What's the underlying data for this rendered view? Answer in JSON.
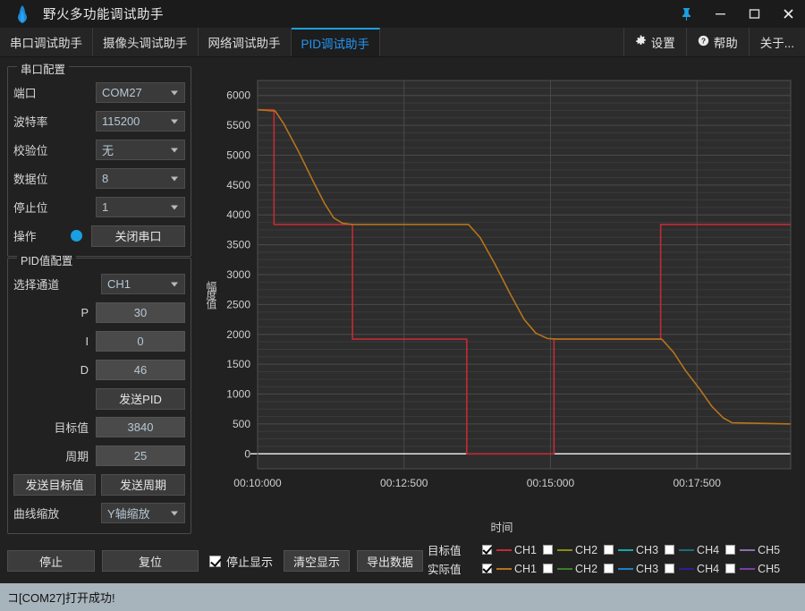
{
  "window": {
    "title": "野火多功能调试助手",
    "logo_icon": "flame-icon",
    "controls": [
      {
        "name": "pin-button",
        "glyph": "📌"
      },
      {
        "name": "minimize-button",
        "glyph": "—"
      },
      {
        "name": "maximize-button",
        "glyph": "◻"
      },
      {
        "name": "close-button",
        "glyph": "✕"
      }
    ]
  },
  "tabs": [
    {
      "label": "串口调试助手",
      "active": false
    },
    {
      "label": "摄像头调试助手",
      "active": false
    },
    {
      "label": "网络调试助手",
      "active": false
    },
    {
      "label": "PID调试助手",
      "active": true
    }
  ],
  "topbuttons": [
    {
      "label": "设置",
      "icon": "gear-icon",
      "glyph": "⚙"
    },
    {
      "label": "帮助",
      "icon": "question-icon",
      "glyph": "❓"
    },
    {
      "label": "关于...",
      "icon": "",
      "glyph": ""
    }
  ],
  "serial_group": {
    "title": "串口配置",
    "port_label": "端口",
    "port_value": "COM27",
    "baud_label": "波特率",
    "baud_value": "115200",
    "parity_label": "校验位",
    "parity_value": "无",
    "data_label": "数据位",
    "data_value": "8",
    "stop_label": "停止位",
    "stop_value": "1",
    "op_label": "操作",
    "op_button": "关闭串口",
    "status_color": "#1a9fe0"
  },
  "pid_group": {
    "title": "PID值配置",
    "channel_label": "选择通道",
    "channel_value": "CH1",
    "p_label": "P",
    "p_value": "30",
    "i_label": "I",
    "i_value": "0",
    "d_label": "D",
    "d_value": "46",
    "send_pid": "发送PID",
    "target_label": "目标值",
    "target_value": "3840",
    "period_label": "周期",
    "period_value": "25",
    "send_target": "发送目标值",
    "send_period": "发送周期",
    "zoom_label": "曲线缩放",
    "zoom_value": "Y轴缩放"
  },
  "actions": {
    "stop": "停止",
    "reset": "复位",
    "stop_display": "停止显示",
    "stop_display_checked": true,
    "clear_display": "清空显示",
    "export_data": "导出数据"
  },
  "statusbar": {
    "message": "コ[COM27]打开成功!"
  },
  "legend": {
    "target_label": "目标值",
    "actual_label": "实际值",
    "target_channels": [
      {
        "label": "CH1",
        "color": "#c32b36",
        "checked": true
      },
      {
        "label": "CH2",
        "color": "#8a8a17",
        "checked": false
      },
      {
        "label": "CH3",
        "color": "#17a8a8",
        "checked": false
      },
      {
        "label": "CH4",
        "color": "#1f6b7a",
        "checked": false
      },
      {
        "label": "CH5",
        "color": "#8a6fb0",
        "checked": false
      }
    ],
    "actual_channels": [
      {
        "label": "CH1",
        "color": "#b5741d",
        "checked": true
      },
      {
        "label": "CH2",
        "color": "#3f7d2b",
        "checked": false
      },
      {
        "label": "CH3",
        "color": "#1f7fc4",
        "checked": false
      },
      {
        "label": "CH4",
        "color": "#2e2090",
        "checked": false
      },
      {
        "label": "CH5",
        "color": "#7a3fa8",
        "checked": false
      }
    ]
  },
  "chart_data": {
    "type": "line",
    "title": "",
    "xlabel": "时间",
    "ylabel": "幅度值",
    "grid": true,
    "legend_position": "bottom",
    "background": "#2d2d2d",
    "xlim": [
      10.0,
      19.1
    ],
    "ylim": [
      -250,
      6250
    ],
    "ytick_values": [
      0,
      500,
      1000,
      1500,
      2000,
      2500,
      3000,
      3500,
      4000,
      4500,
      5000,
      5500,
      6000
    ],
    "ytick_labels": [
      "0",
      "500",
      "1000",
      "1500",
      "2000",
      "2500",
      "3000",
      "3500",
      "4000",
      "4500",
      "5000",
      "5500",
      "6000"
    ],
    "xtick_values": [
      10.0,
      12.5,
      15.0,
      17.5
    ],
    "xtick_labels": [
      "00:10:000",
      "00:12:500",
      "00:15:000",
      "00:17:500"
    ],
    "zero_line": 0,
    "series": [
      {
        "name": "目标值 CH1",
        "color": "#c32b36",
        "x": [
          10.0,
          10.28,
          10.28,
          11.62,
          11.62,
          13.57,
          13.57,
          15.06,
          15.06,
          16.88,
          16.88,
          19.1
        ],
        "y": [
          5760,
          5760,
          3840,
          3840,
          1920,
          1920,
          0,
          0,
          1920,
          1920,
          3840,
          3840
        ]
      },
      {
        "name": "实际值 CH1",
        "color": "#b5741d",
        "x": [
          10.0,
          10.3,
          10.45,
          10.7,
          10.95,
          11.15,
          11.3,
          11.45,
          11.62,
          13.6,
          13.8,
          14.05,
          14.3,
          14.55,
          14.75,
          14.95,
          15.12,
          15.3,
          16.9,
          17.1,
          17.3,
          17.55,
          17.75,
          17.95,
          18.1,
          19.1
        ],
        "y": [
          5760,
          5740,
          5520,
          5060,
          4560,
          4180,
          3950,
          3860,
          3840,
          3840,
          3620,
          3180,
          2700,
          2250,
          2020,
          1930,
          1920,
          1920,
          1920,
          1700,
          1400,
          1080,
          800,
          600,
          520,
          500
        ]
      }
    ],
    "note": "actual (orange) tracks target (red) with first-order lag; target is a descending then ascending staircase 5760->3840->1920->0->1920->3840"
  }
}
